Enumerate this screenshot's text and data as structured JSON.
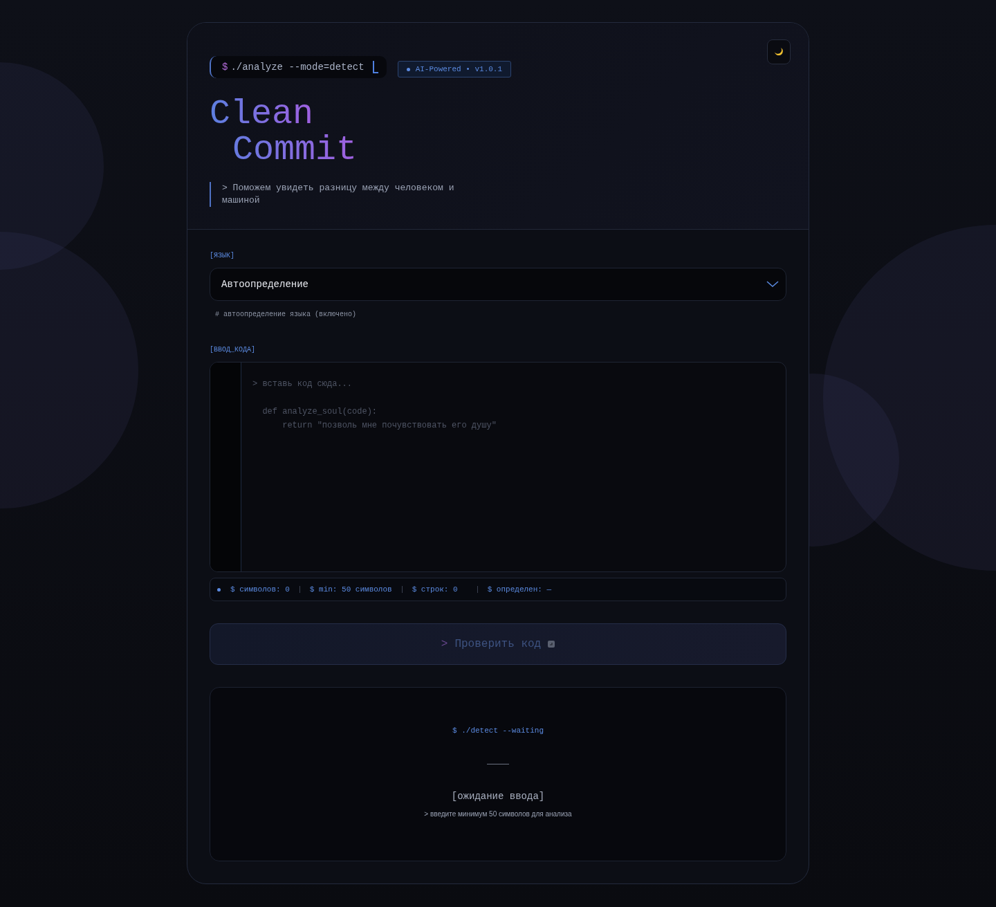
{
  "header": {
    "command": {
      "prompt": "$",
      "text": "./analyze --mode=detect"
    },
    "badge": "AI-Powered • v1.0.1",
    "theme_toggle": {
      "dark": true
    },
    "title": [
      "Clean",
      "Commit"
    ],
    "subtitle": "> Поможем увидеть разницу между человеком и машиной"
  },
  "language": {
    "label": "[ЯЗЫК]",
    "value": "Автоопределение",
    "hint": "# автоопределение языка (включено)"
  },
  "code_input": {
    "label": "[ВВОД_КОДА]",
    "placeholder": "> вставь код сюда...\n\n  def analyze_soul(code):\n      return \"позволь мне почувствовать его душу\""
  },
  "stats": [
    "$ символов: 0",
    "$ min: 50 символов",
    "$ строк: 0",
    "$ определен: —"
  ],
  "submit": {
    "prompt": ">",
    "label": "Проверить код",
    "disabled": true
  },
  "result": {
    "command": "$ ./detect --waiting",
    "title": "[ожидание ввода]",
    "hint": "> введите минимум 50 символов для анализа"
  }
}
